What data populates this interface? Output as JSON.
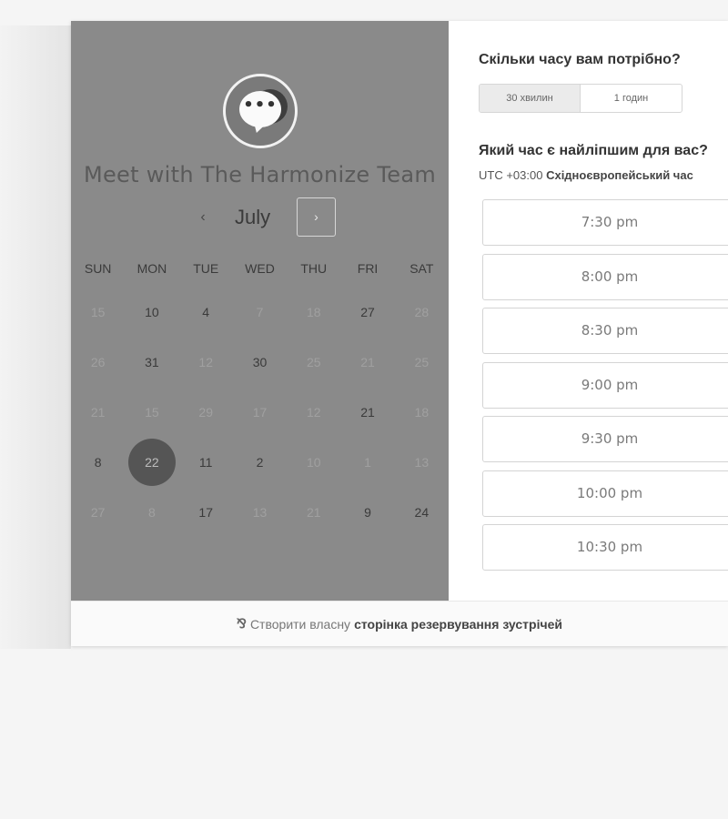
{
  "team_name": "Meet with The Harmonize Team",
  "calendar": {
    "month": "July",
    "prev_arrow": "‹",
    "next_arrow": "›",
    "weekdays": [
      "SUN",
      "MON",
      "TUE",
      "WED",
      "THU",
      "FRI",
      "SAT"
    ],
    "weeks": [
      [
        "15",
        "10",
        "4",
        "7",
        "18",
        "27",
        "28"
      ],
      [
        "26",
        "31",
        "12",
        "30",
        "25",
        "21",
        "25"
      ],
      [
        "21",
        "15",
        "29",
        "17",
        "12",
        "21",
        "18"
      ],
      [
        "8",
        "22",
        "11",
        "2",
        "10",
        "1",
        "13"
      ],
      [
        "27",
        "8",
        "17",
        "13",
        "21",
        "9",
        "24"
      ]
    ],
    "selected_day": "22"
  },
  "booking": {
    "duration_question": "Скільки часу вам потрібно?",
    "durations": [
      "30 хвилин",
      "1 годин"
    ],
    "time_question": "Який час є найліпшим для вас?",
    "timezone_prefix": "UTC +03:00",
    "timezone_name": "Східноєвропейський час",
    "slots": [
      "7:30 pm",
      "8:00 pm",
      "8:30 pm",
      "9:00 pm",
      "9:30 pm",
      "10:00 pm",
      "10:30 pm"
    ]
  },
  "footer": {
    "logo_glyph": "⅋",
    "text": "Створити власну",
    "link": "сторінка резервування зустрічей"
  }
}
